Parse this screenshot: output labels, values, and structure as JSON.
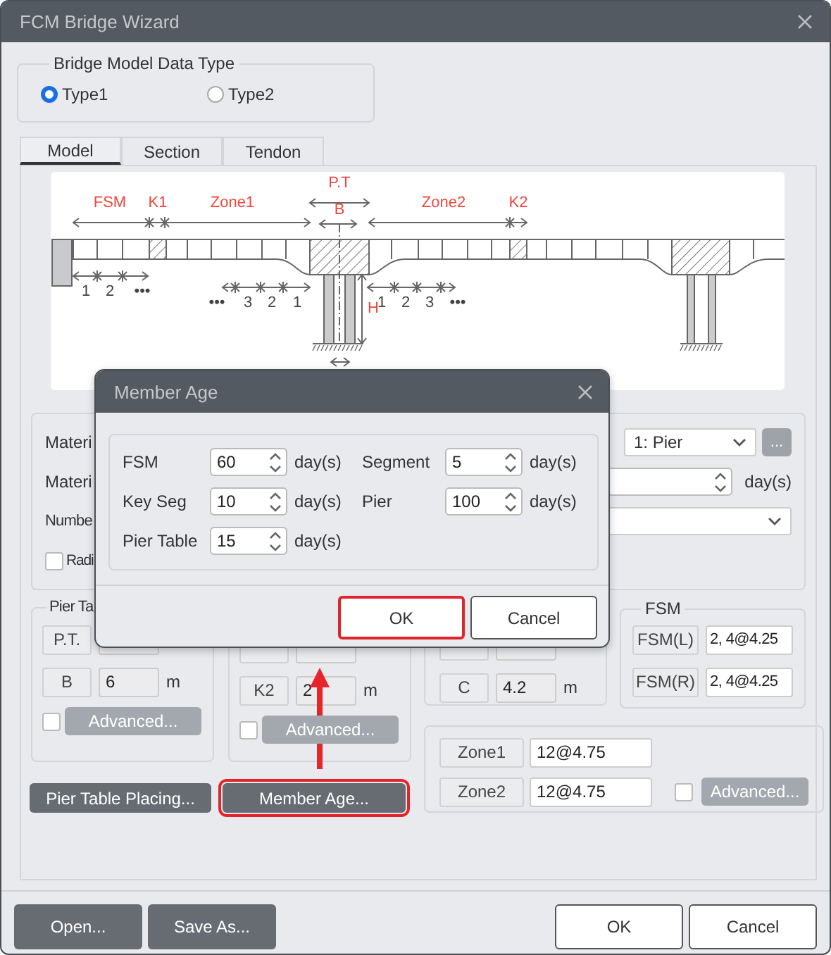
{
  "window": {
    "title": "FCM Bridge Wizard"
  },
  "data_type": {
    "legend": "Bridge Model Data Type",
    "options": [
      {
        "label": "Type1",
        "selected": true
      },
      {
        "label": "Type2",
        "selected": false
      }
    ]
  },
  "tabs": [
    {
      "label": "Model",
      "selected": true
    },
    {
      "label": "Section",
      "selected": false
    },
    {
      "label": "Tendon",
      "selected": false
    }
  ],
  "diagram": {
    "zone_labels": [
      "FSM",
      "K1",
      "Zone1",
      "P.T",
      "B",
      "Zone2",
      "K2",
      "H"
    ],
    "segment_numbers": [
      [
        "1",
        "2",
        "•••"
      ],
      [
        "•••",
        "3",
        "2",
        "1"
      ],
      [
        "1",
        "2",
        "3",
        "•••"
      ]
    ]
  },
  "material_group": {
    "row_labels": [
      "Materi",
      "Materi",
      "Numbe"
    ],
    "radial": {
      "label": "Radi",
      "checked": false
    },
    "pier_select": "1: Pier",
    "more_button": "...",
    "age_unit": "day(s)"
  },
  "pier_table_group": {
    "title": "Pier Ta",
    "rows": [
      {
        "button": "P.T.",
        "disabled": true
      },
      {
        "button": "B",
        "value": "6",
        "unit": "m",
        "disabled": true
      }
    ],
    "advanced": {
      "label": "Advanced...",
      "checked": false,
      "disabled": true
    }
  },
  "key_group": {
    "rows": [
      {
        "disabled": true
      },
      {
        "button": "K2",
        "value": "2",
        "unit": "m",
        "disabled": true
      }
    ],
    "advanced": {
      "label": "Advanced...",
      "checked": false,
      "disabled": true
    }
  },
  "closure_group": {
    "rows": [
      {
        "disabled": true
      },
      {
        "button": "C",
        "value": "4.2",
        "unit": "m",
        "disabled": true
      }
    ]
  },
  "fsm_group": {
    "title": "FSM",
    "rows": [
      {
        "button": "FSM(L)",
        "value": "2, 4@4.25",
        "disabled": false
      },
      {
        "button": "FSM(R)",
        "value": "2, 4@4.25",
        "disabled": false
      }
    ]
  },
  "zone_group": {
    "rows": [
      {
        "button": "Zone1",
        "value": "12@4.75",
        "disabled": false
      },
      {
        "button": "Zone2",
        "value": "12@4.75",
        "disabled": false
      }
    ],
    "advanced": {
      "label": "Advanced...",
      "checked": false,
      "disabled": true
    }
  },
  "action_buttons": [
    {
      "label": "Pier Table Placing...",
      "highlighted": false
    },
    {
      "label": "Member Age...",
      "highlighted": true
    }
  ],
  "footer": {
    "left_buttons": [
      "Open...",
      "Save As..."
    ],
    "right_buttons": [
      "OK",
      "Cancel"
    ]
  },
  "member_age_dialog": {
    "title": "Member Age",
    "fields": [
      {
        "label": "FSM",
        "value": "60",
        "unit": "day(s)"
      },
      {
        "label": "Segment",
        "value": "5",
        "unit": "day(s)"
      },
      {
        "label": "Key Seg",
        "value": "10",
        "unit": "day(s)"
      },
      {
        "label": "Pier",
        "value": "100",
        "unit": "day(s)"
      },
      {
        "label": "Pier Table",
        "value": "15",
        "unit": "day(s)"
      }
    ],
    "buttons": [
      {
        "label": "OK",
        "highlighted": true
      },
      {
        "label": "Cancel",
        "highlighted": false
      }
    ]
  }
}
